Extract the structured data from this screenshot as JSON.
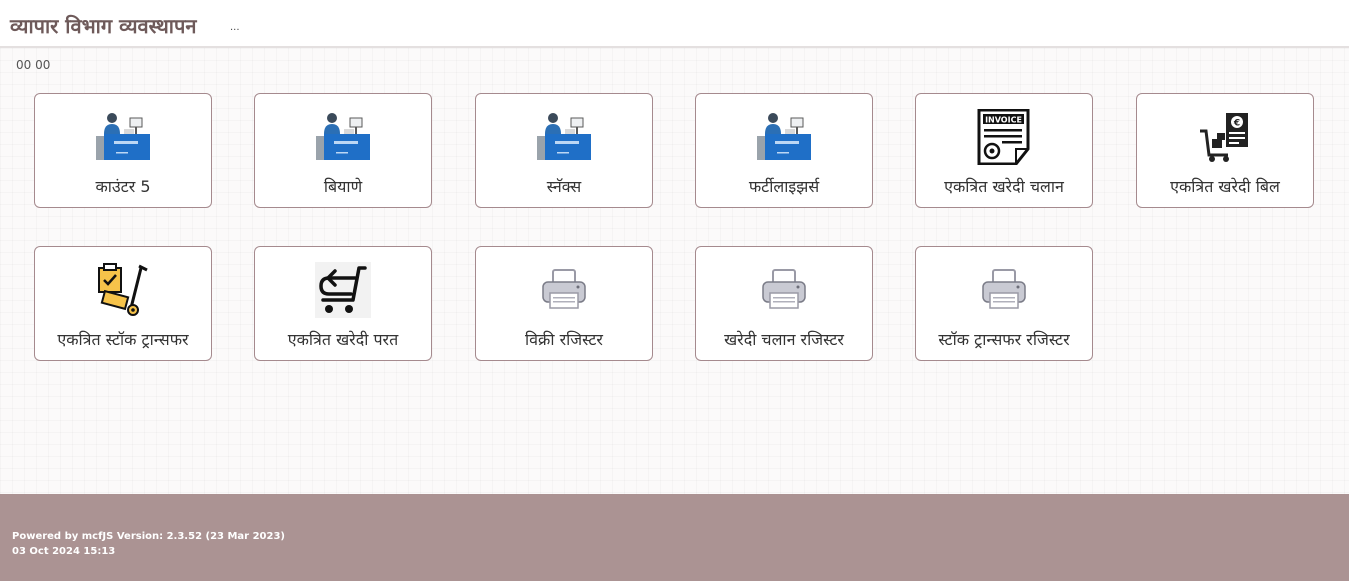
{
  "header": {
    "title": "व्यापार विभाग व्यवस्थापन",
    "dots": "..."
  },
  "clock": "00 00",
  "tiles": [
    {
      "label": "काउंटर 5",
      "icon": "cashier-counter-icon"
    },
    {
      "label": "बियाणे",
      "icon": "cashier-counter-icon"
    },
    {
      "label": "स्नॅक्स",
      "icon": "cashier-counter-icon"
    },
    {
      "label": "फर्टीलाइझर्स",
      "icon": "cashier-counter-icon"
    },
    {
      "label": "एकत्रित खरेदी चलान",
      "icon": "invoice-icon"
    },
    {
      "label": "एकत्रित खरेदी बिल",
      "icon": "purchase-bill-cart-icon"
    },
    {
      "label": "एकत्रित स्टॉक ट्रान्सफर",
      "icon": "stock-transfer-trolley-icon"
    },
    {
      "label": "एकत्रित खरेदी परत",
      "icon": "cart-return-icon"
    },
    {
      "label": "विक्री रजिस्टर",
      "icon": "printer-icon"
    },
    {
      "label": "खरेदी चलान रजिस्टर",
      "icon": "printer-icon"
    },
    {
      "label": "स्टॉक ट्रान्सफर रजिस्टर",
      "icon": "printer-icon"
    }
  ],
  "footer": {
    "powered_prefix": "Powered by ",
    "powered_brand": "mcfJS",
    "powered_suffix": " Version: 2.3.52 (23 Mar 2023)",
    "datetime": "03 Oct 2024 15:13"
  },
  "colors": {
    "title": "#6e5a5a",
    "tile_border": "#a58a8e",
    "footer_bg": "#ab9393",
    "counter_blue": "#1f6fc7"
  }
}
